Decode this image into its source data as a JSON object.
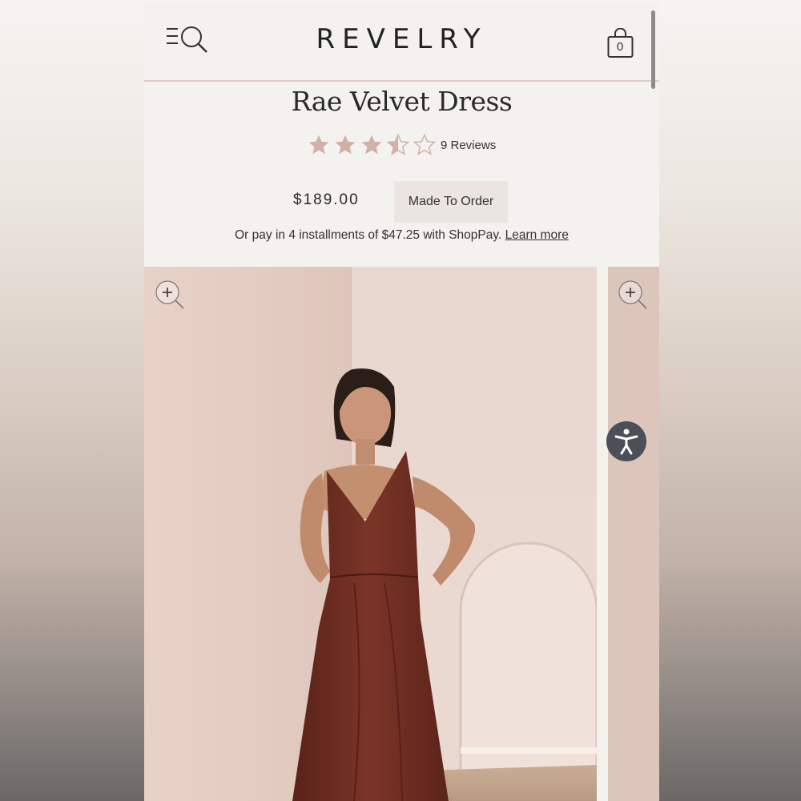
{
  "header": {
    "logo": "REVELRY",
    "cart_count": "0",
    "menu_icon": "menu-search-icon",
    "cart_icon": "shopping-bag-icon"
  },
  "product": {
    "title": "Rae Velvet Dress",
    "rating": 3.5,
    "rating_max": 5,
    "reviews_label": "9 Reviews",
    "price": "$189.00",
    "availability": "Made To Order",
    "installments_text": "Or pay in 4 installments of $47.25 with ShopPay.",
    "learn_more": "Learn more"
  },
  "gallery": {
    "zoom_icon": "zoom-in-icon",
    "accessibility_icon": "accessibility-icon"
  },
  "colors": {
    "star": "#d2b1a5",
    "dress": "#6e2e22",
    "background": "#f4f2ef",
    "accessibility": "#4b4f57"
  }
}
